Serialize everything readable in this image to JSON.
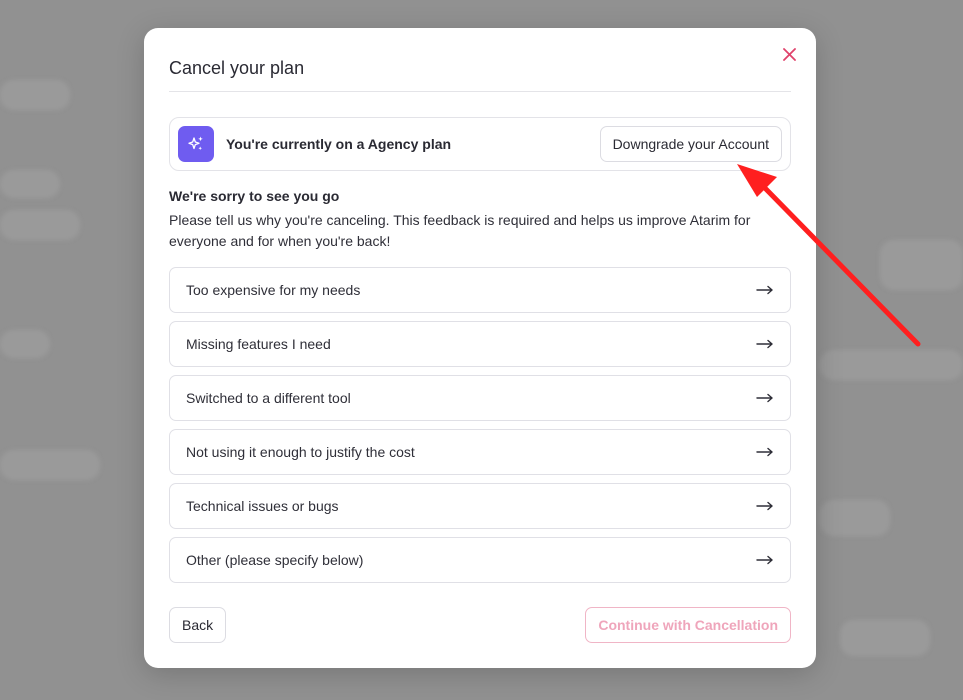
{
  "modal": {
    "title": "Cancel your plan",
    "close_icon": "close-icon"
  },
  "plan": {
    "icon": "sparkles-icon",
    "text": "You're currently on a Agency plan",
    "downgrade_label": "Downgrade your Account"
  },
  "feedback": {
    "heading": "We're sorry to see you go",
    "description": "Please tell us why you're canceling. This feedback is required and helps us improve Atarim for everyone and for when you're back!"
  },
  "reasons": [
    {
      "label": "Too expensive for my needs"
    },
    {
      "label": "Missing features I need"
    },
    {
      "label": "Switched to a different tool"
    },
    {
      "label": "Not using it enough to justify the cost"
    },
    {
      "label": "Technical issues or bugs"
    },
    {
      "label": "Other (please specify below)"
    }
  ],
  "footer": {
    "back_label": "Back",
    "continue_label": "Continue with Cancellation"
  },
  "colors": {
    "accent": "#6f5cf0",
    "danger": "#e0426b",
    "annotation_arrow": "#ff1f1f"
  }
}
